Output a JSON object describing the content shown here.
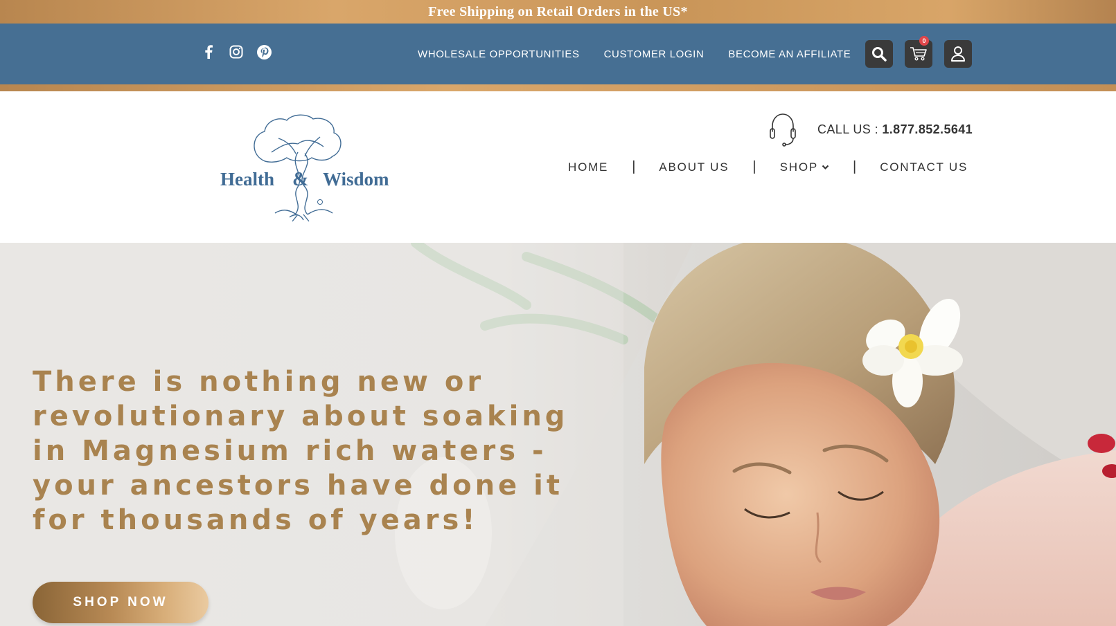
{
  "promo": {
    "text": "Free Shipping on Retail Orders in the US*"
  },
  "topbar": {
    "social_icons": [
      "facebook-icon",
      "instagram-icon",
      "pinterest-icon"
    ],
    "links": [
      "WHOLESALE OPPORTUNITIES",
      "CUSTOMER LOGIN",
      "BECOME AN AFFILIATE"
    ],
    "cart_count": "0",
    "colors": {
      "bar": "#466f93",
      "gold": "#c99558",
      "icon_button": "#3a3a3a"
    }
  },
  "header": {
    "logo": {
      "word_left": "Health",
      "ampersand": "&",
      "word_right": "Wisdom",
      "registered": "®"
    },
    "call_label": "CALL US : ",
    "phone": "1.877.852.5641",
    "nav": [
      "HOME",
      "ABOUT US",
      "SHOP",
      "CONTACT US"
    ],
    "nav_separator": "|"
  },
  "hero": {
    "headline": "There is nothing new or revolutionary about soaking in Magnesium rich waters - your ancestors have done it for thousands of years!",
    "cta": "SHOP NOW",
    "colors": {
      "headline": "#a9834f"
    }
  }
}
